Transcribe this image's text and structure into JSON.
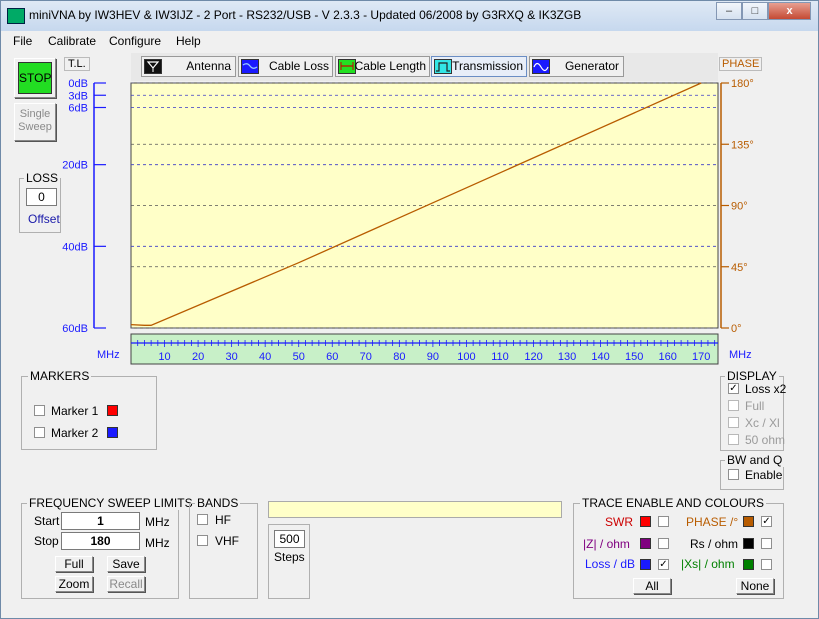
{
  "window": {
    "title": "miniVNA by IW3HEV & IW3IJZ - 2 Port - RS232/USB - V 2.3.3 - Updated 06/2008 by G3RXQ & IK3ZGB",
    "minimize": "–",
    "maximize": "□",
    "close": "x"
  },
  "menu": [
    "File",
    "Calibrate",
    "Configure",
    "Help"
  ],
  "left": {
    "stop_label": "STOP",
    "single_sweep_line1": "Single",
    "single_sweep_line2": "Sweep",
    "loss_title": "LOSS",
    "loss_value": "0",
    "loss_offset": "Offset"
  },
  "tabs": [
    {
      "label": "Antenna",
      "icon": "antenna-icon",
      "color": "#ffffff"
    },
    {
      "label": "Cable Loss",
      "icon": "cable-loss-icon",
      "color": "#1a1aff"
    },
    {
      "label": "Cable Length",
      "icon": "cable-length-icon",
      "color": "#22e022"
    },
    {
      "label": "Transmission",
      "icon": "transmission-icon",
      "color": "#33e6e6"
    },
    {
      "label": "Generator",
      "icon": "generator-icon",
      "color": "#1a1aff"
    }
  ],
  "tl_label": "T.L.",
  "phase_label": "PHASE",
  "chart_data": {
    "type": "line",
    "x": [
      0,
      4,
      6,
      50,
      170
    ],
    "series": [
      {
        "name": "PHASE",
        "color": "#b85c00",
        "values": [
          2.5,
          2,
          2,
          48,
          180
        ]
      }
    ],
    "xlabel_left": "MHz",
    "xlabel_right": "MHz",
    "xlim": [
      0,
      175
    ],
    "xticks": [
      10,
      20,
      30,
      40,
      50,
      60,
      70,
      80,
      90,
      100,
      110,
      120,
      130,
      140,
      150,
      160,
      170
    ],
    "left_axis": {
      "unit": "dB",
      "ticks": [
        "0dB",
        "3dB",
        "6dB",
        "20dB",
        "40dB",
        "60dB"
      ],
      "values": [
        0,
        3,
        6,
        20,
        40,
        60
      ],
      "ylim": [
        0,
        60
      ]
    },
    "right_axis": {
      "unit": "degrees",
      "ticks": [
        "180°",
        "135°",
        "90°",
        "45°",
        "0°"
      ],
      "values": [
        180,
        135,
        90,
        45,
        0
      ],
      "ylim": [
        0,
        180
      ]
    },
    "plot_bg": "#ffffc8",
    "band_bg": "#c8f0c8",
    "grid": true
  },
  "markers": {
    "title": "MARKERS",
    "items": [
      {
        "label": "Marker 1",
        "color": "#ff0000"
      },
      {
        "label": "Marker 2",
        "color": "#1a1aff"
      }
    ]
  },
  "display": {
    "title": "DISPLAY",
    "items": [
      {
        "label": "Loss x2",
        "checked": true,
        "enabled": true
      },
      {
        "label": "Full",
        "checked": false,
        "enabled": false
      },
      {
        "label": "Xc / Xl",
        "checked": false,
        "enabled": false
      },
      {
        "label": "50 ohm",
        "checked": false,
        "enabled": false
      }
    ]
  },
  "bwq": {
    "title": "BW and Q",
    "enable_label": "Enable"
  },
  "sweep": {
    "title": "FREQUENCY SWEEP LIMITS",
    "start_label": "Start",
    "start_value": "1",
    "start_unit": "MHz",
    "stop_label": "Stop",
    "stop_value": "180",
    "stop_unit": "MHz",
    "full": "Full",
    "save": "Save",
    "zoom": "Zoom",
    "recall": "Recall"
  },
  "bands": {
    "title": "BANDS",
    "hf": "HF",
    "vhf": "VHF"
  },
  "status_text": "",
  "steps": {
    "value": "500",
    "label": "Steps"
  },
  "trace": {
    "title": "TRACE ENABLE AND COLOURS",
    "left": [
      {
        "label": "SWR",
        "color": "#ff0000",
        "text_color": "#cc0000",
        "checked": false
      },
      {
        "label": "|Z| / ohm",
        "color": "#800080",
        "text_color": "#800080",
        "checked": false
      },
      {
        "label": "Loss / dB",
        "color": "#1a1aff",
        "text_color": "#1a1aff",
        "checked": true
      }
    ],
    "right": [
      {
        "label": "PHASE /°",
        "color": "#b85c00",
        "text_color": "#b85c00",
        "checked": true
      },
      {
        "label": "Rs / ohm",
        "color": "#000000",
        "text_color": "#000000",
        "checked": false
      },
      {
        "label": "|Xs| / ohm",
        "color": "#008000",
        "text_color": "#008000",
        "checked": false
      }
    ],
    "all": "All",
    "none": "None"
  }
}
